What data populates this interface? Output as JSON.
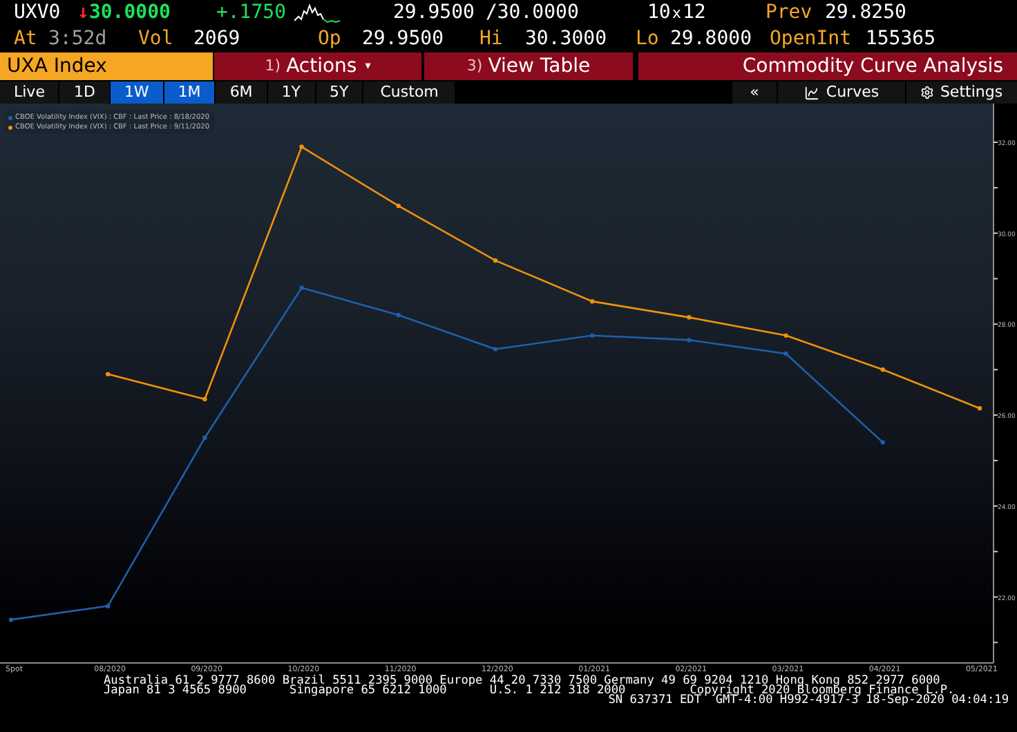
{
  "quote": {
    "ticker": "UXV0",
    "direction": "↓",
    "last": "30.0000",
    "change": "+.1750",
    "bid": "29.9500",
    "ask": "/30.0000",
    "size_bid": "10",
    "size_sep": "x",
    "size_ask": "12",
    "prev": {
      "label": "Prev",
      "value": "29.8250"
    }
  },
  "stats": [
    {
      "label": "At",
      "value": "3:52d",
      "muted": true
    },
    {
      "label": "Vol",
      "value": "2069",
      "muted": false
    },
    {
      "label": "Op",
      "value": "29.9500",
      "muted": false
    },
    {
      "label": "Hi",
      "value": "30.3000",
      "muted": false
    },
    {
      "label": "Lo",
      "value": "29.8000",
      "muted": false
    },
    {
      "label": "OpenInt",
      "value": "155365",
      "muted": false
    }
  ],
  "toolbar": {
    "security": "UXA Index",
    "actions": {
      "number": "1)",
      "label": "Actions",
      "caret": "▾"
    },
    "view_table": {
      "number": "3)",
      "label": "View Table"
    },
    "title": "Commodity Curve Analysis"
  },
  "ranges": [
    {
      "label": "Live",
      "selected": false
    },
    {
      "label": "1D",
      "selected": false
    },
    {
      "label": "1W",
      "selected": true
    },
    {
      "label": "1M",
      "selected": true
    },
    {
      "label": "6M",
      "selected": false
    },
    {
      "label": "1Y",
      "selected": false
    },
    {
      "label": "5Y",
      "selected": false
    },
    {
      "label": "Custom",
      "selected": false
    }
  ],
  "right_tools": {
    "collapse": "«",
    "curves": "Curves",
    "settings": "Settings"
  },
  "chart": {
    "chart_data": {
      "type": "line",
      "legend": "upper left",
      "categories": [
        "Spot",
        "08/2020",
        "09/2020",
        "10/2020",
        "11/2020",
        "12/2020",
        "01/2021",
        "02/2021",
        "03/2021",
        "04/2021",
        "05/2021"
      ],
      "series": [
        {
          "name": "CBOE Volatility Index (VIX) : CBF : Last Price : 8/18/2020",
          "color": "#1f5fa8",
          "marker": "circle",
          "values": [
            21.5,
            21.8,
            25.5,
            28.8,
            28.2,
            27.45,
            27.75,
            27.65,
            27.35,
            25.4,
            null
          ]
        },
        {
          "name": "CBOE Volatility Index (VIX) : CBF : Last Price : 9/11/2020",
          "color": "#f0920a",
          "marker": "circle",
          "values": [
            null,
            26.9,
            26.35,
            31.9,
            30.6,
            29.4,
            28.5,
            28.15,
            27.75,
            27.0,
            26.15
          ]
        }
      ],
      "ylim": [
        20.55,
        32.85
      ],
      "yticks": [
        {
          "value": 22,
          "label": "22.00"
        },
        {
          "value": 24,
          "label": "24.00"
        },
        {
          "value": 26,
          "label": "26.00"
        },
        {
          "value": 28,
          "label": "28.00"
        },
        {
          "value": 30,
          "label": "30.00"
        },
        {
          "value": 32,
          "label": "32.00"
        }
      ]
    }
  },
  "footer": [
    "Australia 61 2 9777 8600 Brazil 5511 2395 9000 Europe 44 20 7330 7500 Germany 49 69 9204 1210 Hong Kong 852 2977 6000",
    "Japan 81 3 4565 8900      Singapore 65 6212 1000      U.S. 1 212 318 2000         Copyright 2020 Bloomberg Finance L.P.",
    "SN 637371 EDT  GMT-4:00 H992-4917-3 18-Sep-2020 04:04:19"
  ]
}
